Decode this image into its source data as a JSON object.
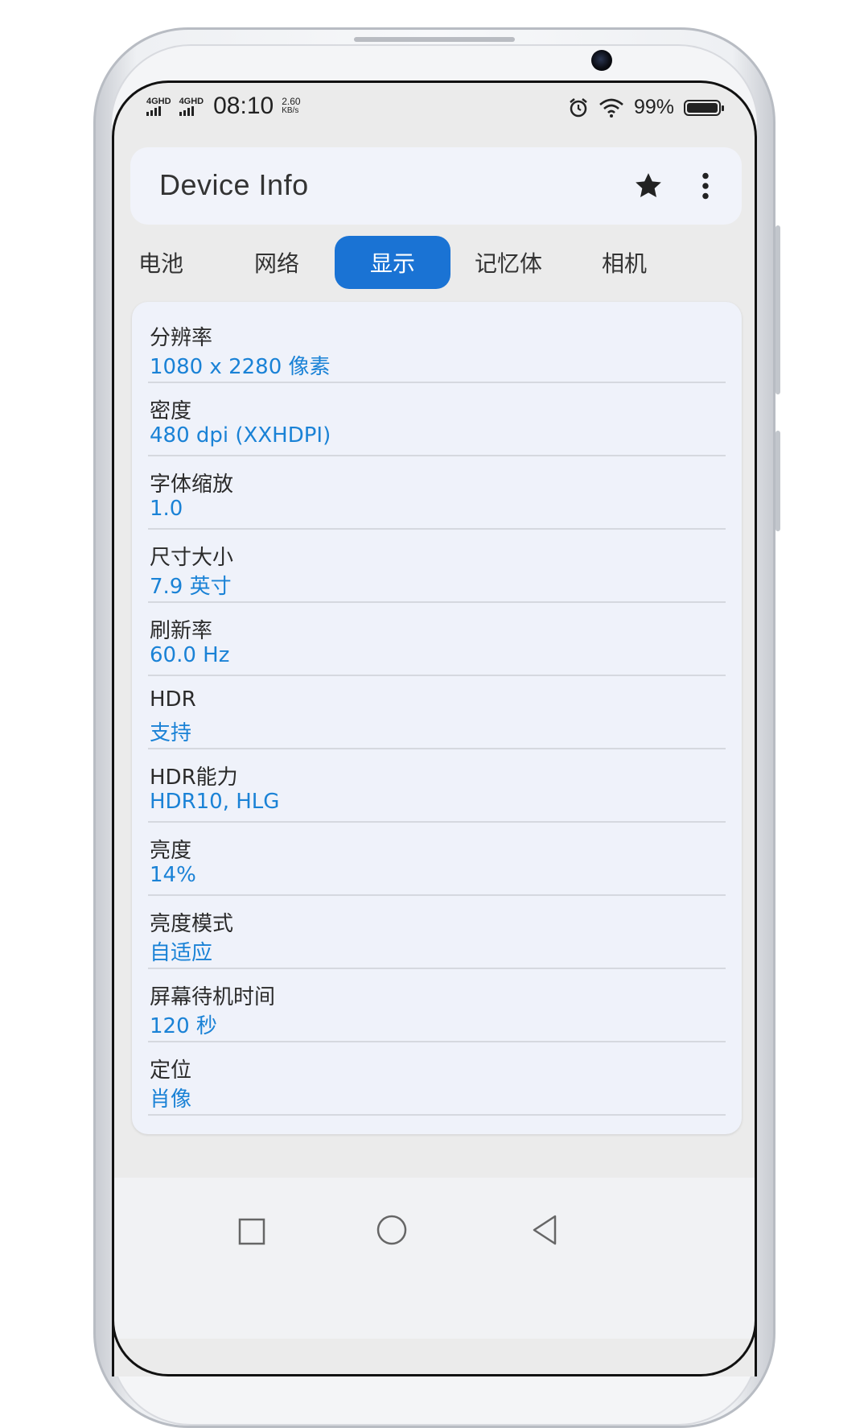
{
  "status_bar": {
    "sim1_label": "4GHD",
    "sim2_label": "4GHD",
    "time": "08:10",
    "speed_value": "2.60",
    "speed_unit": "KB/s",
    "battery_percent": "99%",
    "battery_level": 0.99,
    "icons": [
      "alarm-icon",
      "wifi-icon",
      "battery-icon"
    ]
  },
  "app_bar": {
    "title": "Device Info",
    "icons": [
      "star-icon",
      "more-vert-icon"
    ]
  },
  "tabs": [
    {
      "label": "电池",
      "active": false
    },
    {
      "label": "网络",
      "active": false
    },
    {
      "label": "显示",
      "active": true
    },
    {
      "label": "记忆体",
      "active": false
    },
    {
      "label": "相机",
      "active": false
    }
  ],
  "display_info": [
    {
      "key": "分辨率",
      "value": "1080 x 2280 像素"
    },
    {
      "key": "密度",
      "value": "480 dpi (XXHDPI)"
    },
    {
      "key": "字体缩放",
      "value": "1.0"
    },
    {
      "key": "尺寸大小",
      "value": "7.9 英寸"
    },
    {
      "key": "刷新率",
      "value": "60.0 Hz"
    },
    {
      "key": "HDR",
      "value": "支持"
    },
    {
      "key": "HDR能力",
      "value": "HDR10, HLG"
    },
    {
      "key": "亮度",
      "value": "14%"
    },
    {
      "key": "亮度模式",
      "value": "自适应"
    },
    {
      "key": "屏幕待机时间",
      "value": "120 秒"
    },
    {
      "key": "定位",
      "value": "肖像"
    }
  ],
  "nav_bar": {
    "icons": [
      "recents-square-icon",
      "home-circle-icon",
      "back-triangle-icon"
    ]
  },
  "colors": {
    "accent": "#1a73d4",
    "value_text": "#1a82d6",
    "card_bg": "#eff2fa",
    "screen_bg": "#ebebeb"
  }
}
